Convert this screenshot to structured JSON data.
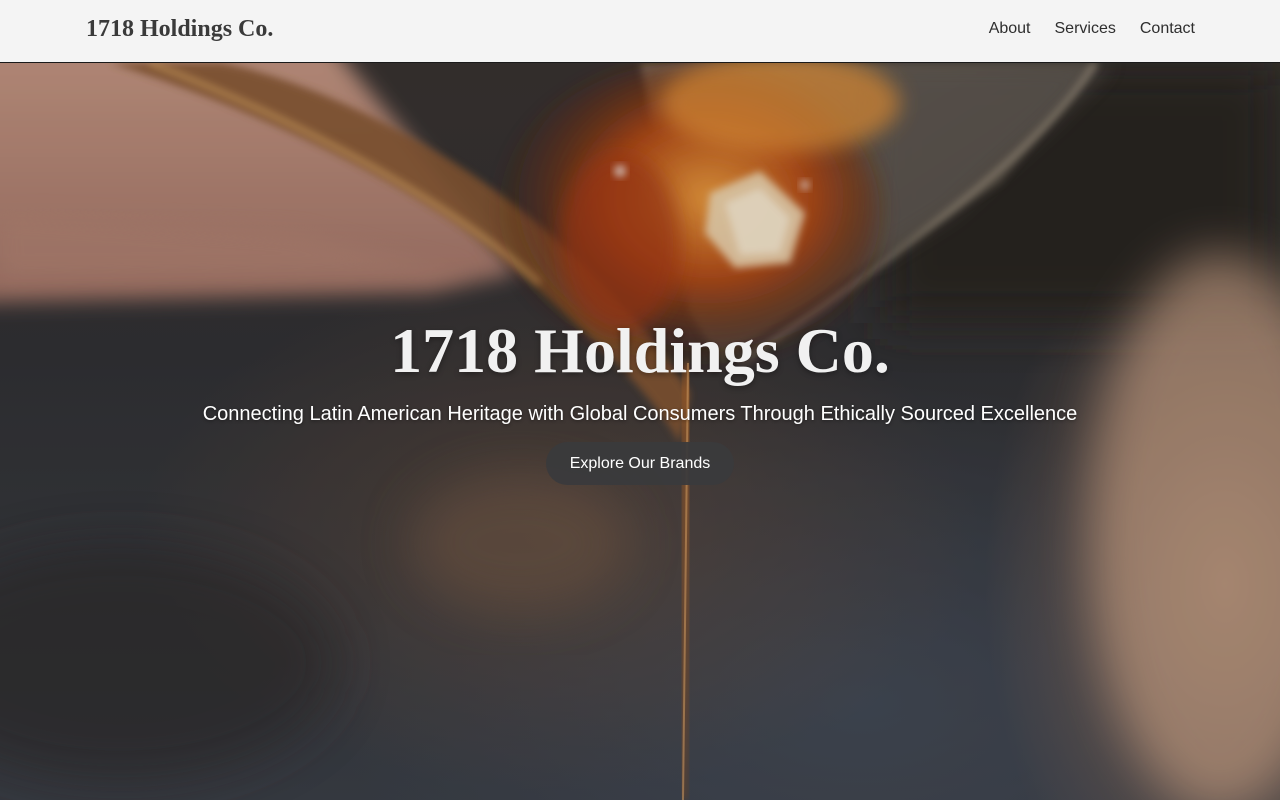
{
  "nav": {
    "brand": "1718 Holdings Co.",
    "links": [
      {
        "label": "About"
      },
      {
        "label": "Services"
      },
      {
        "label": "Contact"
      }
    ]
  },
  "hero": {
    "title": "1718 Holdings Co.",
    "subtitle": "Connecting Latin American Heritage with Global Consumers Through Ethically Sourced Excellence",
    "cta_label": "Explore Our Brands",
    "background_image": "amber spirit pouring from glass"
  },
  "colors": {
    "nav_background": "#f4f4f4",
    "brand_text": "#3a3a3a",
    "cta_background": "#3a3a3c",
    "amber_accent": "#d9822b"
  }
}
